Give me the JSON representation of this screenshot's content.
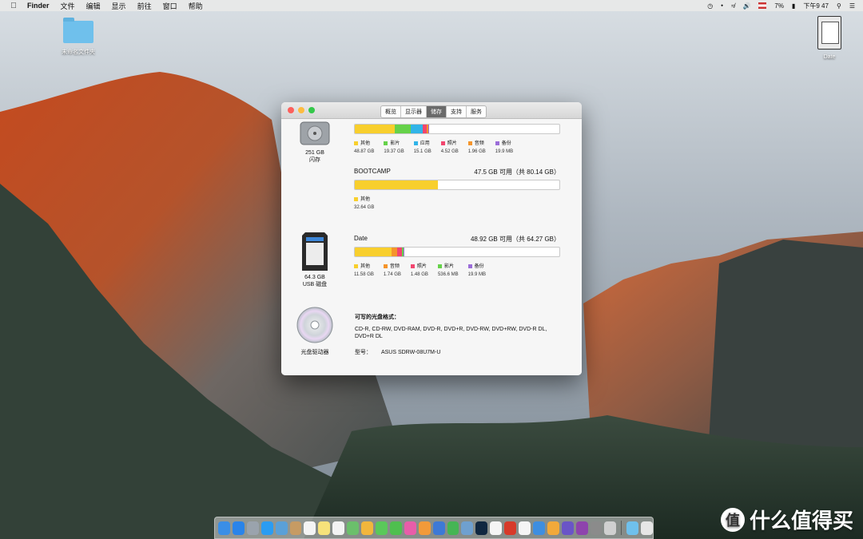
{
  "menubar": {
    "app": "Finder",
    "items": [
      "文件",
      "编辑",
      "显示",
      "前往",
      "窗口",
      "帮助"
    ],
    "battery": "7%",
    "clock": "下午9 47"
  },
  "desktop": {
    "folder_label": "未命名文件夹",
    "drive_label": "Date"
  },
  "window": {
    "tabs": [
      "概览",
      "显示器",
      "储存",
      "支持",
      "服务"
    ],
    "active_tab": "储存",
    "devices": [
      {
        "size": "251 GB",
        "type": "闪存",
        "volumes": [
          {
            "name": "",
            "availability": "",
            "segments": [
              {
                "label": "其他",
                "size": "48.87 GB",
                "color": "#f8cf2d",
                "fraction": 0.195
              },
              {
                "label": "影片",
                "size": "19.37 GB",
                "color": "#66d24a",
                "fraction": 0.077
              },
              {
                "label": "应用",
                "size": "15.1 GB",
                "color": "#31b4e8",
                "fraction": 0.06
              },
              {
                "label": "照片",
                "size": "4.52 GB",
                "color": "#f2466f",
                "fraction": 0.018
              },
              {
                "label": "音频",
                "size": "1.96 GB",
                "color": "#f5942b",
                "fraction": 0.008
              },
              {
                "label": "备份",
                "size": "19.9 MB",
                "color": "#9b6dd9",
                "fraction": 0.002
              }
            ]
          },
          {
            "name": "BOOTCAMP",
            "availability": "47.5 GB 可用（共 80.14 GB）",
            "segments": [
              {
                "label": "其他",
                "size": "32.64 GB",
                "color": "#f8cf2d",
                "fraction": 0.407
              }
            ]
          }
        ]
      },
      {
        "size": "64.3 GB",
        "type": "USB 磁盘",
        "volumes": [
          {
            "name": "Date",
            "availability": "48.92 GB 可用（共 64.27 GB）",
            "segments": [
              {
                "label": "其他",
                "size": "11.58 GB",
                "color": "#f8cf2d",
                "fraction": 0.18
              },
              {
                "label": "音频",
                "size": "1.74 GB",
                "color": "#f5942b",
                "fraction": 0.027
              },
              {
                "label": "照片",
                "size": "1.48 GB",
                "color": "#f2466f",
                "fraction": 0.023
              },
              {
                "label": "影片",
                "size": "536.6 MB",
                "color": "#66d24a",
                "fraction": 0.008
              },
              {
                "label": "备份",
                "size": "19.9 MB",
                "color": "#9b6dd9",
                "fraction": 0.002
              }
            ]
          }
        ]
      }
    ],
    "optical": {
      "device_label": "光盘驱动器",
      "formats_title": "可写的光盘格式：",
      "formats": "CD-R, CD-RW, DVD-RAM, DVD-R, DVD+R, DVD-RW, DVD+RW, DVD-R DL, DVD+R DL",
      "model_label": "型号：",
      "model": "ASUS SDRW-08U7M-U"
    }
  },
  "dock": {
    "apps": [
      {
        "name": "finder",
        "color": "#3a8ee6"
      },
      {
        "name": "app-store",
        "color": "#2a84e9"
      },
      {
        "name": "launchpad",
        "color": "#9aa3ad"
      },
      {
        "name": "safari",
        "color": "#2b9cf2"
      },
      {
        "name": "mail",
        "color": "#5aa0d8"
      },
      {
        "name": "contacts",
        "color": "#c69b63"
      },
      {
        "name": "calendar",
        "color": "#f4f4f4"
      },
      {
        "name": "notes",
        "color": "#f7e27a"
      },
      {
        "name": "reminders",
        "color": "#f3f3f3"
      },
      {
        "name": "maps",
        "color": "#6bbf6b"
      },
      {
        "name": "photos",
        "color": "#f2b63c"
      },
      {
        "name": "messages",
        "color": "#5ac85a"
      },
      {
        "name": "facetime",
        "color": "#4fbf4f"
      },
      {
        "name": "itunes",
        "color": "#e85da9"
      },
      {
        "name": "ibooks",
        "color": "#f29a3a"
      },
      {
        "name": "keynote",
        "color": "#3d79d6"
      },
      {
        "name": "numbers",
        "color": "#45b554"
      },
      {
        "name": "preview",
        "color": "#6fa0cf"
      },
      {
        "name": "photoshop",
        "color": "#0f2740"
      },
      {
        "name": "pages",
        "color": "#f5f5f5"
      },
      {
        "name": "netease-music",
        "color": "#d73a2a"
      },
      {
        "name": "music",
        "color": "#f5f5f5"
      },
      {
        "name": "quicktime",
        "color": "#3e8ee0"
      },
      {
        "name": "movies",
        "color": "#f2a93a"
      },
      {
        "name": "final-cut",
        "color": "#6a55c7"
      },
      {
        "name": "imovie",
        "color": "#8e44ad"
      },
      {
        "name": "system-preferences",
        "color": "#8b8b8b"
      },
      {
        "name": "disk-utility",
        "color": "#d0d0d0"
      }
    ],
    "right": [
      {
        "name": "downloads-folder",
        "color": "#6fc0ec"
      },
      {
        "name": "trash",
        "color": "#e6e6e6"
      }
    ]
  },
  "watermark": {
    "logo": "值",
    "text": "什么值得买"
  }
}
